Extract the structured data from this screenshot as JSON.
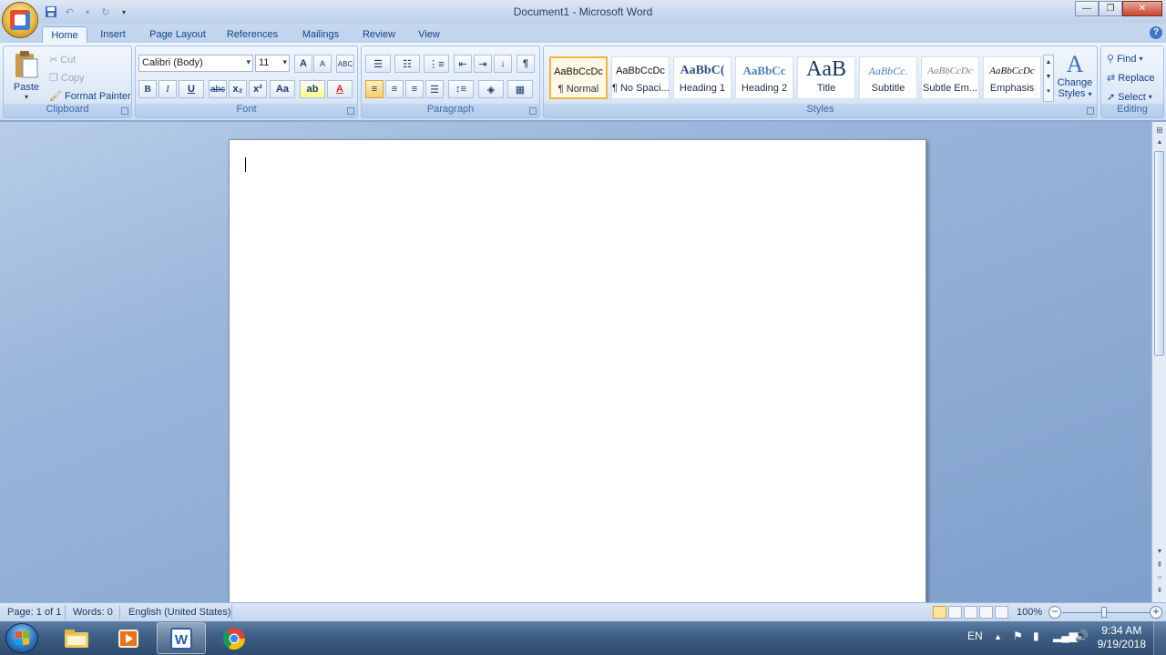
{
  "window": {
    "title": "Document1 - Microsoft Word",
    "controls": [
      "minimize",
      "restore",
      "close"
    ]
  },
  "quick_access": [
    "save-icon",
    "undo-icon",
    "redo-icon",
    "customize-icon"
  ],
  "tabs": [
    {
      "label": "Home",
      "active": true
    },
    {
      "label": "Insert"
    },
    {
      "label": "Page Layout"
    },
    {
      "label": "References"
    },
    {
      "label": "Mailings"
    },
    {
      "label": "Review"
    },
    {
      "label": "View"
    }
  ],
  "clipboard": {
    "label": "Clipboard",
    "paste": "Paste",
    "cut": "Cut",
    "copy": "Copy",
    "format_painter": "Format Painter"
  },
  "font": {
    "label": "Font",
    "font_name": "Calibri (Body)",
    "font_size": "11",
    "grow": "A",
    "shrink": "A",
    "clear": "ABC",
    "bold": "B",
    "italic": "I",
    "underline": "U",
    "strike": "abc",
    "subscript": "x₂",
    "superscript": "x²",
    "change_case": "Aa",
    "highlight": "ab",
    "font_color": "A",
    "highlight_color": "#ffff00",
    "font_color_value": "#e02020"
  },
  "paragraph": {
    "label": "Paragraph",
    "pilcrow": "¶"
  },
  "styles": {
    "label": "Styles",
    "items": [
      {
        "preview": "AaBbCcDc",
        "name": "¶ Normal",
        "selected": true
      },
      {
        "preview": "AaBbCcDc",
        "name": "¶ No Spaci..."
      },
      {
        "preview": "AaBbC(",
        "name": "Heading 1"
      },
      {
        "preview": "AaBbCc",
        "name": "Heading 2"
      },
      {
        "preview": "AaB",
        "name": "Title"
      },
      {
        "preview": "AaBbCc.",
        "name": "Subtitle"
      },
      {
        "preview": "AaBbCcDc",
        "name": "Subtle Em..."
      },
      {
        "preview": "AaBbCcDc",
        "name": "Emphasis"
      }
    ],
    "change_styles_line1": "Change",
    "change_styles_line2": "Styles"
  },
  "editing": {
    "label": "Editing",
    "find": "Find",
    "replace": "Replace",
    "select": "Select"
  },
  "status": {
    "page": "Page: 1 of 1",
    "words": "Words: 0",
    "language": "English (United States)",
    "zoom": "100%"
  },
  "taskbar": {
    "lang": "EN",
    "time": "9:34 AM",
    "date": "9/19/2018"
  },
  "colors": {
    "ribbon_bg": "#dce8f7",
    "accent": "#15428b"
  }
}
